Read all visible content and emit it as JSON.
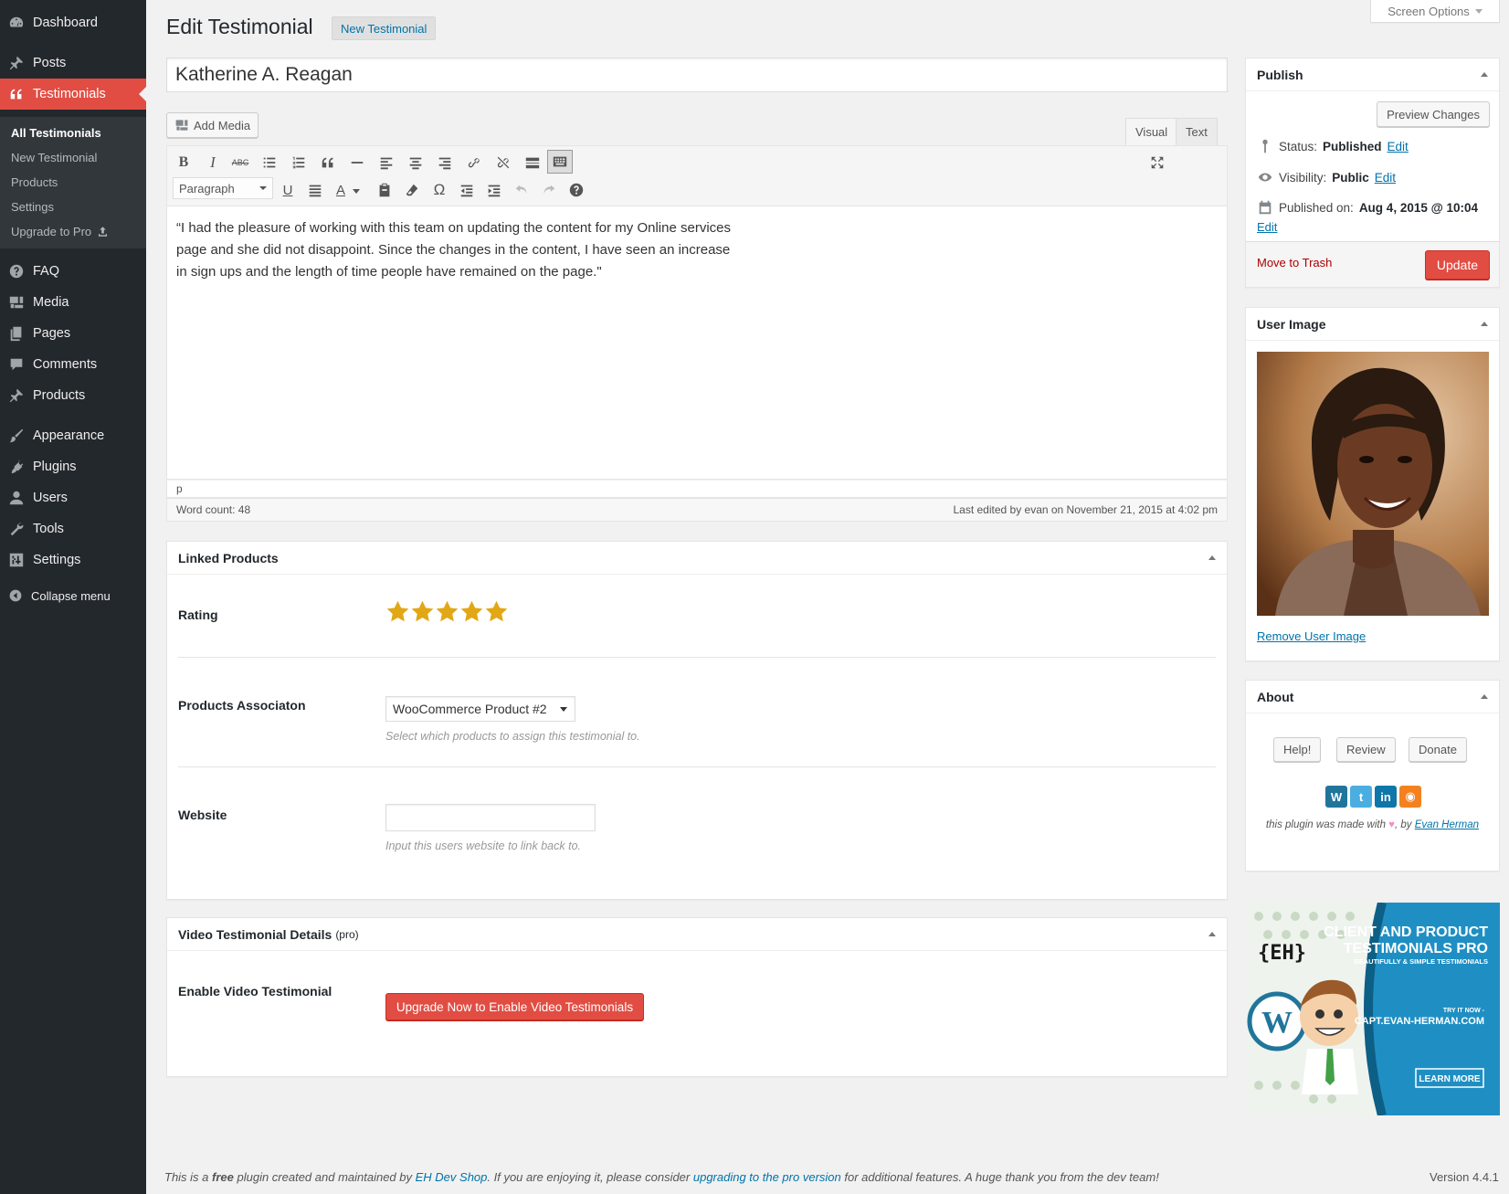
{
  "sidebar": {
    "items": [
      {
        "label": "Dashboard",
        "icon": "dashboard-icon"
      },
      {
        "label": "Posts",
        "icon": "pin-icon"
      },
      {
        "label": "Testimonials",
        "icon": "quote-icon"
      },
      {
        "label": "FAQ",
        "icon": "help-icon"
      },
      {
        "label": "Media",
        "icon": "media-icon"
      },
      {
        "label": "Pages",
        "icon": "pages-icon"
      },
      {
        "label": "Comments",
        "icon": "comments-icon"
      },
      {
        "label": "Products",
        "icon": "pin-icon"
      },
      {
        "label": "Appearance",
        "icon": "brush-icon"
      },
      {
        "label": "Plugins",
        "icon": "plug-icon"
      },
      {
        "label": "Users",
        "icon": "user-icon"
      },
      {
        "label": "Tools",
        "icon": "wrench-icon"
      },
      {
        "label": "Settings",
        "icon": "sliders-icon"
      }
    ],
    "submenu": [
      "All Testimonials",
      "New Testimonial",
      "Products",
      "Settings",
      "Upgrade to Pro"
    ],
    "collapse_label": "Collapse menu"
  },
  "header": {
    "screen_options": "Screen Options",
    "title": "Edit Testimonial",
    "add_new": "New Testimonial"
  },
  "post": {
    "title": "Katherine A. Reagan",
    "content": "“I had the pleasure of working with this team on updating the content for my  Online services page and she did not disappoint. Since the changes in the content, I have seen an increase in sign ups and the length of time people have remained on the page.\""
  },
  "editor": {
    "add_media": "Add Media",
    "tab_visual": "Visual",
    "tab_text": "Text",
    "format": "Paragraph",
    "path": "p",
    "word_count": "Word count: 48",
    "last_edited": "Last edited by evan on November 21, 2015 at 4:02 pm"
  },
  "linked_products": {
    "title": "Linked Products",
    "rating_label": "Rating",
    "rating": 5,
    "rating_max": 5,
    "association_label": "Products Associaton",
    "association_value": "WooCommerce Product #2",
    "association_help": "Select which products to assign this testimonial to.",
    "website_label": "Website",
    "website_value": "",
    "website_help": "Input this users website to link back to."
  },
  "video": {
    "title": "Video Testimonial Details",
    "pro_tag": "(pro)",
    "enable_label": "Enable Video Testimonial",
    "upgrade_button": "Upgrade Now to Enable Video Testimonials"
  },
  "publish": {
    "title": "Publish",
    "preview": "Preview Changes",
    "status_label": "Status:",
    "status_value": "Published",
    "visibility_label": "Visibility:",
    "visibility_value": "Public",
    "published_label": "Published on:",
    "published_value": "Aug 4, 2015 @ 10:04",
    "edit": "Edit",
    "trash": "Move to Trash",
    "update": "Update"
  },
  "user_image": {
    "title": "User Image",
    "remove": "Remove User Image"
  },
  "about": {
    "title": "About",
    "help": "Help!",
    "review": "Review",
    "donate": "Donate",
    "made_with_prefix": "this plugin was made with",
    "made_with_by": ", by",
    "author": "Evan Herman"
  },
  "banner": {
    "logo": "{EH}",
    "line1": "CLIENT AND PRODUCT",
    "line2": "TESTIMONIALS PRO",
    "line3": "BEAUTIFULLY & SIMPLE TESTIMONIALS",
    "try": "TRY IT NOW -",
    "url": "CAPT.EVAN-HERMAN.COM",
    "cta": "LEARN MORE"
  },
  "footer": {
    "t1": "This is a ",
    "free": "free",
    "t2": " plugin created and maintained by ",
    "shop": "EH Dev Shop",
    "t3": ". If you are enjoying it, please consider ",
    "upgrade_link": "upgrading to the pro version",
    "t4": " for additional features. A huge thank you from the dev team!",
    "version": "Version 4.4.1"
  },
  "colors": {
    "accent": "#e14d43",
    "sidebar_bg": "#23282d",
    "link": "#0073aa",
    "star": "#e2a714"
  }
}
